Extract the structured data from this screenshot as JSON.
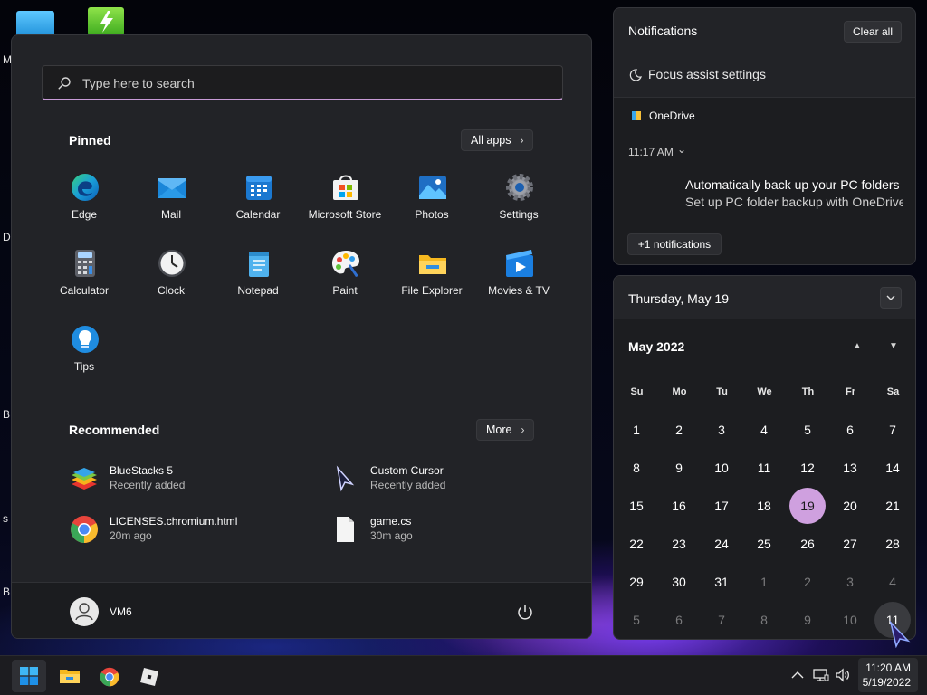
{
  "desktop": {
    "edge_letters": [
      "M",
      "Da",
      "B",
      "s",
      "B"
    ]
  },
  "start_menu": {
    "search_placeholder": "Type here to search",
    "pinned_title": "Pinned",
    "all_apps_label": "All apps",
    "pinned_apps": [
      {
        "label": "Edge",
        "icon": "edge-icon"
      },
      {
        "label": "Mail",
        "icon": "mail-icon"
      },
      {
        "label": "Calendar",
        "icon": "calendar-icon"
      },
      {
        "label": "Microsoft Store",
        "icon": "store-icon"
      },
      {
        "label": "Photos",
        "icon": "photos-icon"
      },
      {
        "label": "Settings",
        "icon": "settings-icon"
      },
      {
        "label": "Calculator",
        "icon": "calculator-icon"
      },
      {
        "label": "Clock",
        "icon": "clock-icon"
      },
      {
        "label": "Notepad",
        "icon": "notepad-icon"
      },
      {
        "label": "Paint",
        "icon": "paint-icon"
      },
      {
        "label": "File Explorer",
        "icon": "folder-icon"
      },
      {
        "label": "Movies & TV",
        "icon": "movies-icon"
      },
      {
        "label": "Tips",
        "icon": "tips-icon"
      }
    ],
    "recommended_title": "Recommended",
    "more_label": "More",
    "recommended": [
      {
        "name": "BlueStacks 5",
        "sub": "Recently added",
        "icon": "bluestacks-icon"
      },
      {
        "name": "Custom Cursor",
        "sub": "Recently added",
        "icon": "cursor-icon"
      },
      {
        "name": "LICENSES.chromium.html",
        "sub": "20m ago",
        "icon": "chrome-icon"
      },
      {
        "name": "game.cs",
        "sub": "30m ago",
        "icon": "file-icon"
      }
    ],
    "user_name": "VM6"
  },
  "notifications": {
    "title": "Notifications",
    "clear_all_label": "Clear all",
    "focus_assist_label": "Focus assist settings",
    "card": {
      "app": "OneDrive",
      "time": "11:17 AM",
      "heading": "Automatically back up your PC folders",
      "body": "Set up PC folder backup with OneDrive"
    },
    "more_label": "+1 notifications"
  },
  "calendar": {
    "date_header": "Thursday, May 19",
    "month_label": "May 2022",
    "weekdays": [
      "Su",
      "Mo",
      "Tu",
      "We",
      "Th",
      "Fr",
      "Sa"
    ],
    "weeks": [
      [
        [
          "1",
          0
        ],
        [
          "2",
          0
        ],
        [
          "3",
          0
        ],
        [
          "4",
          0
        ],
        [
          "5",
          0
        ],
        [
          "6",
          0
        ],
        [
          "7",
          0
        ]
      ],
      [
        [
          "8",
          0
        ],
        [
          "9",
          0
        ],
        [
          "10",
          0
        ],
        [
          "11",
          0
        ],
        [
          "12",
          0
        ],
        [
          "13",
          0
        ],
        [
          "14",
          0
        ]
      ],
      [
        [
          "15",
          0
        ],
        [
          "16",
          0
        ],
        [
          "17",
          0
        ],
        [
          "18",
          0
        ],
        [
          "19",
          2
        ],
        [
          "20",
          0
        ],
        [
          "21",
          0
        ]
      ],
      [
        [
          "22",
          0
        ],
        [
          "23",
          0
        ],
        [
          "24",
          0
        ],
        [
          "25",
          0
        ],
        [
          "26",
          0
        ],
        [
          "27",
          0
        ],
        [
          "28",
          0
        ]
      ],
      [
        [
          "29",
          0
        ],
        [
          "30",
          0
        ],
        [
          "31",
          0
        ],
        [
          "1",
          1
        ],
        [
          "2",
          1
        ],
        [
          "3",
          1
        ],
        [
          "4",
          1
        ]
      ],
      [
        [
          "5",
          1
        ],
        [
          "6",
          1
        ],
        [
          "7",
          1
        ],
        [
          "8",
          1
        ],
        [
          "9",
          1
        ],
        [
          "10",
          1
        ],
        [
          "11",
          3
        ]
      ]
    ]
  },
  "taskbar": {
    "time": "11:20 AM",
    "date": "5/19/2022"
  },
  "colors": {
    "accent": "#cfa0df",
    "panel_bg": "#222327",
    "taskbar_bg": "#1c1c20"
  }
}
